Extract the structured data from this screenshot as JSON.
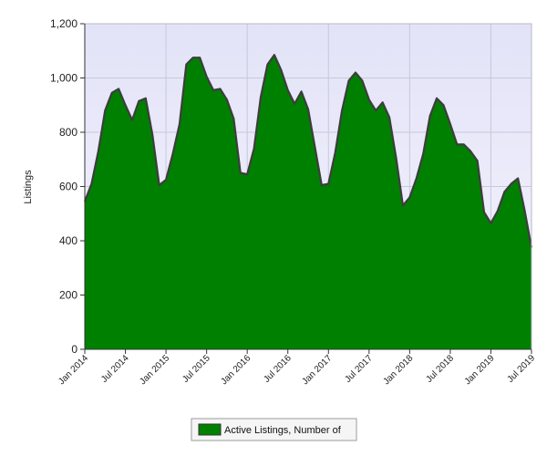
{
  "chart_data": {
    "type": "area",
    "ylabel": "Listings",
    "ylim": [
      0,
      1200
    ],
    "yticks": [
      0,
      200,
      400,
      600,
      800,
      1000,
      1200
    ],
    "ytick_labels": [
      "0",
      "200",
      "400",
      "600",
      "800",
      "1,000",
      "1,200"
    ],
    "xlim": [
      "2014-01",
      "2019-07"
    ],
    "xtick_labels": [
      "Jan 2014",
      "Jul 2014",
      "Jan 2015",
      "Jul 2015",
      "Jan 2016",
      "Jul 2016",
      "Jan 2017",
      "Jul 2017",
      "Jan 2018",
      "Jul 2018",
      "Jan 2019",
      "Jul 2019"
    ],
    "grid": true,
    "legend_position": "bottom-center",
    "series": [
      {
        "name": "Active Listings, Number of",
        "color": "#008000",
        "x": [
          "2014-01",
          "2014-02",
          "2014-03",
          "2014-04",
          "2014-05",
          "2014-06",
          "2014-07",
          "2014-08",
          "2014-09",
          "2014-10",
          "2014-11",
          "2014-12",
          "2015-01",
          "2015-02",
          "2015-03",
          "2015-04",
          "2015-05",
          "2015-06",
          "2015-07",
          "2015-08",
          "2015-09",
          "2015-10",
          "2015-11",
          "2015-12",
          "2016-01",
          "2016-02",
          "2016-03",
          "2016-04",
          "2016-05",
          "2016-06",
          "2016-07",
          "2016-08",
          "2016-09",
          "2016-10",
          "2016-11",
          "2016-12",
          "2017-01",
          "2017-02",
          "2017-03",
          "2017-04",
          "2017-05",
          "2017-06",
          "2017-07",
          "2017-08",
          "2017-09",
          "2017-10",
          "2017-11",
          "2017-12",
          "2018-01",
          "2018-02",
          "2018-03",
          "2018-04",
          "2018-05",
          "2018-06",
          "2018-07",
          "2018-08",
          "2018-09",
          "2018-10",
          "2018-11",
          "2018-12",
          "2019-01",
          "2019-02",
          "2019-03",
          "2019-04",
          "2019-05",
          "2019-06",
          "2019-07"
        ],
        "values": [
          545,
          610,
          730,
          880,
          945,
          960,
          900,
          845,
          915,
          925,
          790,
          605,
          625,
          720,
          830,
          1050,
          1075,
          1075,
          1005,
          955,
          960,
          920,
          850,
          650,
          645,
          740,
          930,
          1050,
          1085,
          1030,
          955,
          905,
          950,
          885,
          745,
          605,
          610,
          725,
          880,
          990,
          1020,
          990,
          920,
          880,
          910,
          855,
          705,
          530,
          560,
          630,
          720,
          860,
          925,
          900,
          830,
          755,
          755,
          730,
          695,
          505,
          465,
          510,
          580,
          610,
          630,
          510,
          375
        ]
      }
    ]
  }
}
